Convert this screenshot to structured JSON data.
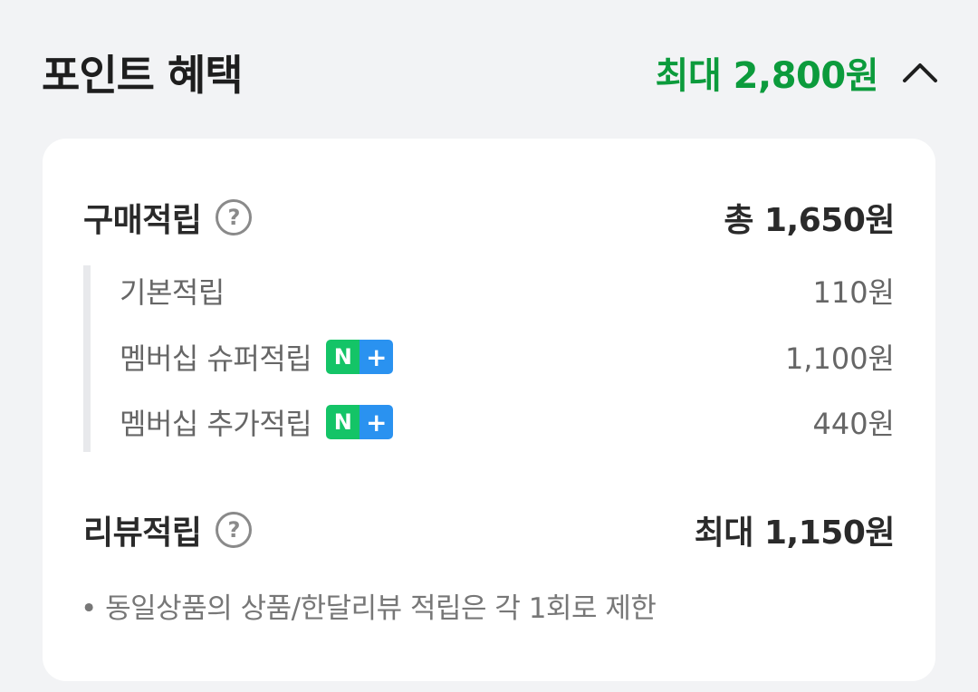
{
  "header": {
    "title": "포인트 혜택",
    "max_label": "최대 2,800원",
    "toggle_icon": "chevron-up-icon",
    "accent_color": "#0c9b3c"
  },
  "purchase": {
    "title": "구매적립",
    "help_glyph": "?",
    "total": "총 1,650원",
    "items": [
      {
        "label": "기본적립",
        "value": "110원",
        "badge": false
      },
      {
        "label": "멤버십 슈퍼적립",
        "value": "1,100원",
        "badge": true
      },
      {
        "label": "멤버십 추가적립",
        "value": "440원",
        "badge": true
      }
    ]
  },
  "badge": {
    "left": "N",
    "right": "+",
    "left_color": "#14c467",
    "right_color": "#2a92f0"
  },
  "review": {
    "title": "리뷰적립",
    "help_glyph": "?",
    "total": "최대 1,150원",
    "note": "• 동일상품의 상품/한달리뷰 적립은 각 1회로 제한"
  }
}
